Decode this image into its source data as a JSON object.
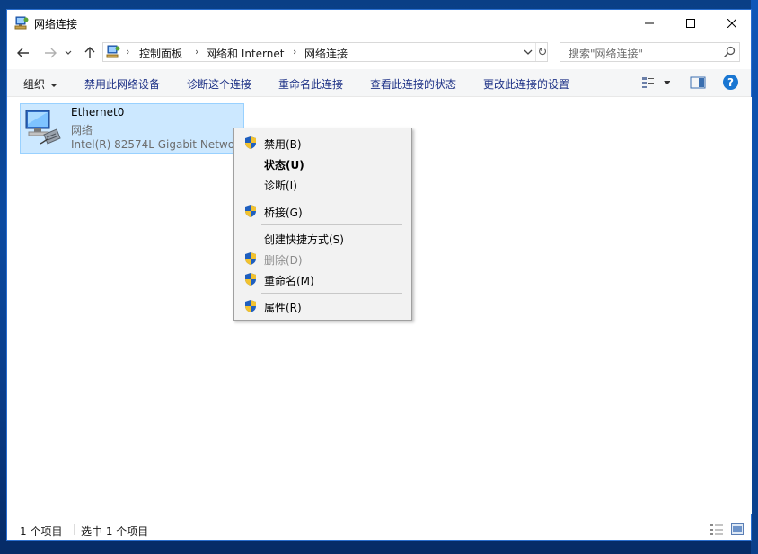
{
  "window": {
    "title": "网络连接",
    "minimize_glyph": "—",
    "maximize_glyph": "☐",
    "close_glyph": "✕"
  },
  "address": {
    "breadcrumbs": [
      "控制面板",
      "网络和 Internet",
      "网络连接"
    ],
    "refresh_glyph": "↻"
  },
  "search": {
    "placeholder": "搜索\"网络连接\""
  },
  "commands": {
    "organize": "组织",
    "disable_device": "禁用此网络设备",
    "diagnose": "诊断这个连接",
    "rename": "重命名此连接",
    "view_status": "查看此连接的状态",
    "change_settings": "更改此连接的设置",
    "help": "?"
  },
  "item": {
    "name": "Ethernet0",
    "status": "网络",
    "adapter": "Intel(R) 82574L Gigabit Netwo..."
  },
  "context_menu": {
    "disable": "禁用(B)",
    "status": "状态(U)",
    "diagnose": "诊断(I)",
    "bridge": "桥接(G)",
    "create_shortcut": "创建快捷方式(S)",
    "delete": "删除(D)",
    "rename": "重命名(M)",
    "properties": "属性(R)"
  },
  "status_bar": {
    "count": "1 个项目",
    "selected": "选中 1 个项目"
  },
  "colors": {
    "selection_bg": "#cce8ff",
    "selection_border": "#99d1ff",
    "command_text": "#1e3287",
    "help_blue": "#1976d2"
  }
}
